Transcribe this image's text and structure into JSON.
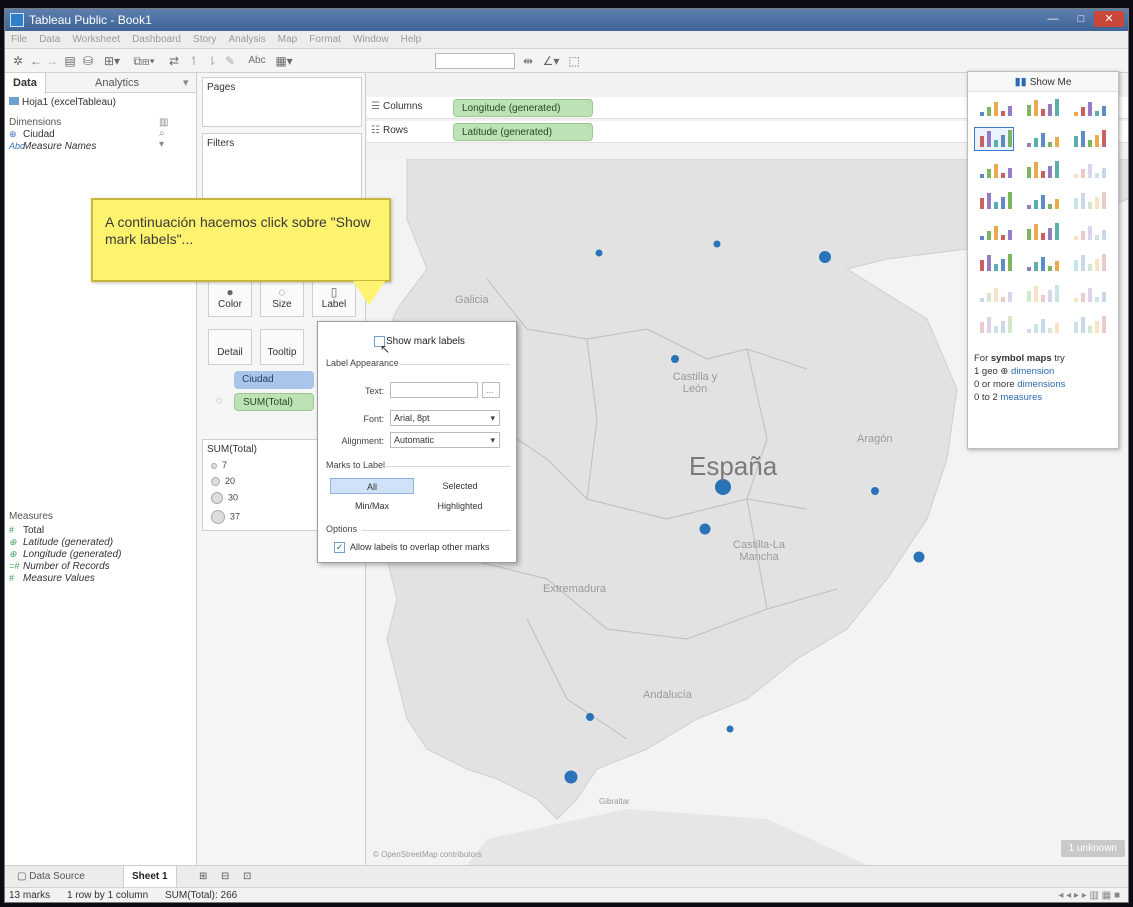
{
  "window": {
    "title": "Tableau Public - Book1"
  },
  "menu": [
    "File",
    "Data",
    "Worksheet",
    "Dashboard",
    "Story",
    "Analysis",
    "Map",
    "Format",
    "Window",
    "Help"
  ],
  "toolbar": {
    "abc_label": "Abc"
  },
  "data_pane": {
    "tab_data": "Data",
    "tab_analytics": "Analytics",
    "tab_caret": "▾",
    "datasource": "Hoja1 (excelTableau)",
    "dimensions_label": "Dimensions",
    "dimensions": [
      {
        "icon": "⊕",
        "name": "Ciudad"
      },
      {
        "icon": "Abc",
        "name": "Measure Names"
      }
    ],
    "measures_label": "Measures",
    "measures": [
      {
        "icon": "#",
        "name": "Total"
      },
      {
        "icon": "⊕",
        "name": "Latitude (generated)"
      },
      {
        "icon": "⊕",
        "name": "Longitude (generated)"
      },
      {
        "icon": "=#",
        "name": "Number of Records"
      },
      {
        "icon": "#",
        "name": "Measure Values"
      }
    ]
  },
  "shelves": {
    "pages": "Pages",
    "filters": "Filters",
    "columns_label": "Columns",
    "rows_label": "Rows",
    "columns_pill": "Longitude (generated)",
    "rows_pill": "Latitude (generated)"
  },
  "marks": {
    "color": "Color",
    "size": "Size",
    "label": "Label",
    "detail": "Detail",
    "tooltip": "Tooltip",
    "pill_ciudad": "Ciudad",
    "pill_sum_total": "SUM(Total)",
    "legend_title": "SUM(Total)",
    "legend_values": [
      "7",
      "20",
      "30",
      "37"
    ]
  },
  "callout": {
    "text": "A continuación hacemos click sobre \"Show mark labels\"..."
  },
  "label_popup": {
    "show_mark_labels": "Show mark labels",
    "label_appearance": "Label Appearance",
    "text_label": "Text:",
    "font_label": "Font:",
    "font_value": "Arial, 8pt",
    "alignment_label": "Alignment:",
    "alignment_value": "Automatic",
    "marks_to_label": "Marks to Label",
    "all": "All",
    "selected": "Selected",
    "minmax": "Min/Max",
    "highlighted": "Highlighted",
    "options": "Options",
    "allow_overlap": "Allow labels to overlap other marks",
    "ellipsis": "..."
  },
  "map": {
    "regions": {
      "galicia": "Galicia",
      "castilla_leon": "Castilla y León",
      "aragon": "Aragón",
      "espana": "España",
      "castilla_mancha": "Castilla-La Mancha",
      "extremadura": "Extremadura",
      "andalucia": "Andalucía",
      "gibraltar": "Gibraltar"
    },
    "attribution": "© OpenStreetMap contributors",
    "unknown_badge": "1 unknown",
    "mark_color": "#2a73b8",
    "land_color": "#e2e2e2",
    "sea_color": "#f3f3f3"
  },
  "show_me": {
    "title": "Show Me",
    "hint_prefix": "For",
    "hint_bold": "symbol maps",
    "hint_suffix": "try",
    "hint_line1_a": "1 geo",
    "hint_line1_b": "dimension",
    "hint_line2_a": "0 or more",
    "hint_line2_b": "dimensions",
    "hint_line3_a": "0 to 2",
    "hint_line3_b": "measures"
  },
  "sheet_tabs": {
    "data_source": "Data Source",
    "sheet1": "Sheet 1"
  },
  "status": {
    "marks": "13 marks",
    "rows_cols": "1 row by 1 column",
    "sum_total": "SUM(Total): 266"
  }
}
